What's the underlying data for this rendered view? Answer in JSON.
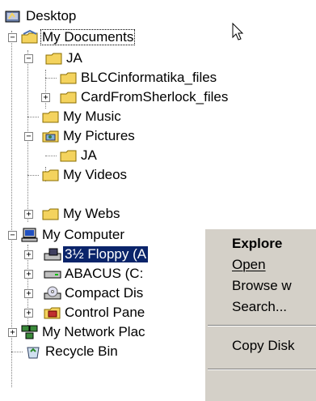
{
  "tree": {
    "items": [
      {
        "label": "Desktop",
        "icon": "desktop-icon"
      },
      {
        "label": "My Documents",
        "icon": "my-documents-folder-icon"
      },
      {
        "label": "JA",
        "icon": "folder-icon"
      },
      {
        "label": "BLCCinformatika_files",
        "icon": "folder-icon"
      },
      {
        "label": "CardFromSherlock_files",
        "icon": "folder-icon"
      },
      {
        "label": "My Music",
        "icon": "folder-icon"
      },
      {
        "label": "My Pictures",
        "icon": "my-pictures-folder-icon"
      },
      {
        "label": "JA",
        "icon": "folder-icon"
      },
      {
        "label": "My Videos",
        "icon": "folder-icon"
      },
      {
        "label": "My Webs",
        "icon": "folder-icon"
      },
      {
        "label": "My Computer",
        "icon": "my-computer-icon"
      },
      {
        "label": "3½ Floppy (A",
        "icon": "floppy-drive-icon"
      },
      {
        "label": "ABACUS (C:",
        "icon": "hard-drive-icon"
      },
      {
        "label": "Compact Dis",
        "icon": "cd-drive-icon"
      },
      {
        "label": "Control Pane",
        "icon": "control-panel-icon"
      },
      {
        "label": "My Network Plac",
        "icon": "network-places-icon"
      },
      {
        "label": "Recycle Bin",
        "icon": "recycle-bin-icon"
      }
    ]
  },
  "context_menu": {
    "explore": "Explore",
    "open": "Open",
    "browse_with": "Browse w",
    "search": "Search...",
    "copy_disk": "Copy Disk"
  },
  "colors": {
    "selection": "#0a246a",
    "menu_bg": "#d4d0c8",
    "folder": "#f4d35e"
  }
}
